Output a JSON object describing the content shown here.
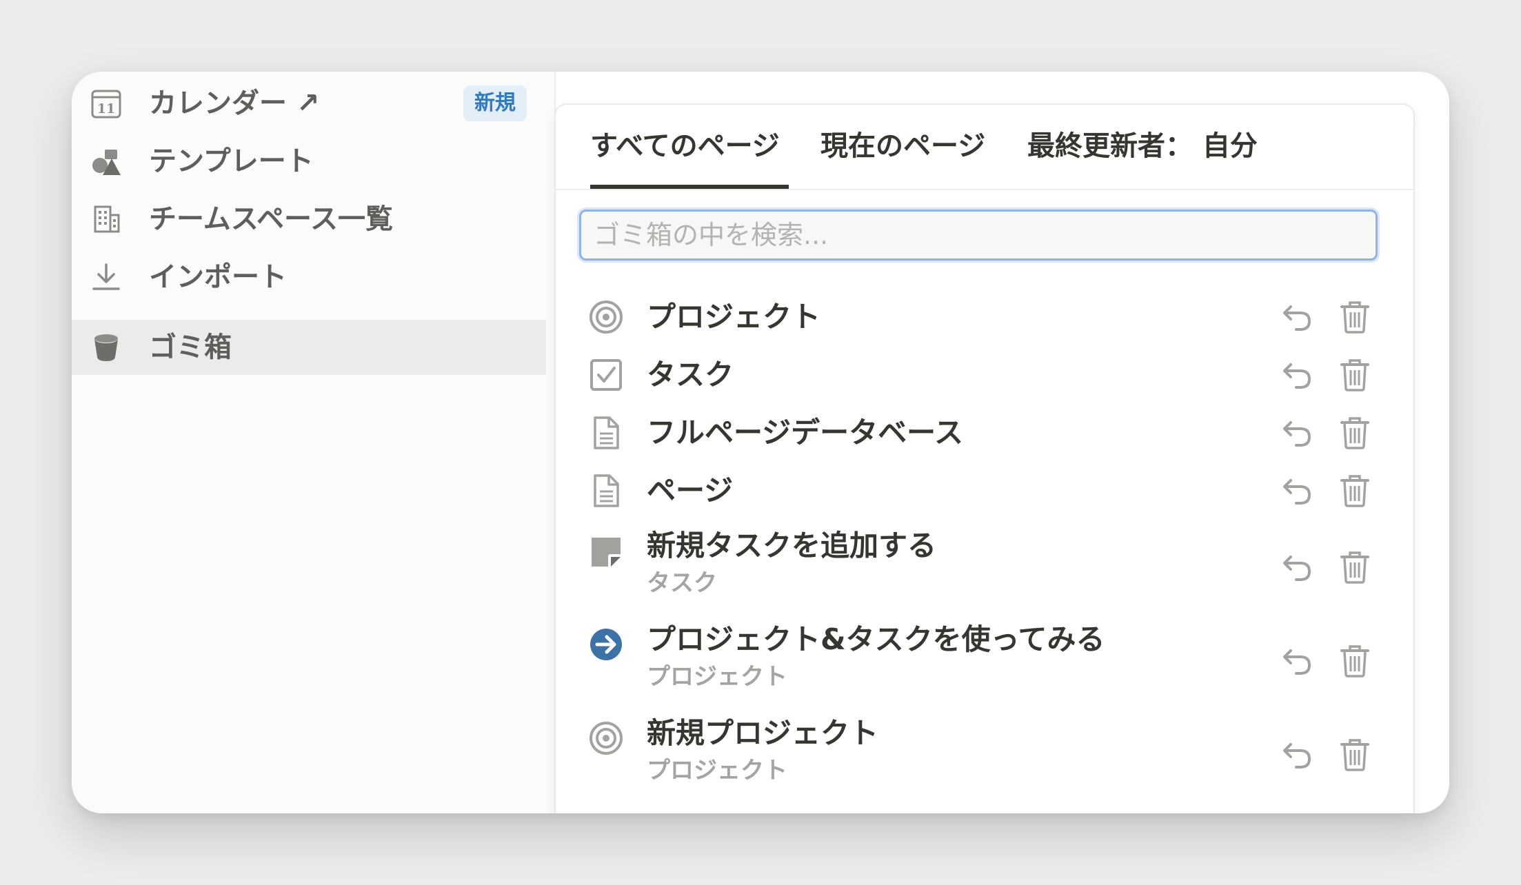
{
  "sidebar": {
    "items": [
      {
        "label": "カレンダー ↗",
        "icon": "calendar-icon",
        "icon_text": "11",
        "badge": "新規"
      },
      {
        "label": "テンプレート",
        "icon": "template-shapes-icon"
      },
      {
        "label": "チームスペース一覧",
        "icon": "building-icon"
      },
      {
        "label": "インポート",
        "icon": "download-icon"
      },
      {
        "label": "ゴミ箱",
        "icon": "trash-bin-icon",
        "active": true
      }
    ]
  },
  "trash": {
    "tabs": [
      {
        "label": "すべてのページ",
        "active": true
      },
      {
        "label": "現在のページ"
      },
      {
        "label": "最終更新者： 自分"
      }
    ],
    "search": {
      "placeholder": "ゴミ箱の中を検索...",
      "value": ""
    },
    "items": [
      {
        "title": "プロジェクト",
        "icon": "target-icon"
      },
      {
        "title": "タスク",
        "icon": "checkbox-icon"
      },
      {
        "title": "フルページデータベース",
        "icon": "document-icon"
      },
      {
        "title": "ページ",
        "icon": "document-icon"
      },
      {
        "title": "新規タスクを追加する",
        "subtitle": "タスク",
        "icon": "sticky-note-icon"
      },
      {
        "title": "プロジェクト&タスクを使ってみる",
        "subtitle": "プロジェクト",
        "icon": "arrow-circle-icon"
      },
      {
        "title": "新規プロジェクト",
        "subtitle": "プロジェクト",
        "icon": "target-icon"
      }
    ],
    "actions": {
      "restore_icon": "restore-icon",
      "delete_icon": "delete-icon"
    }
  },
  "colors": {
    "background": "#ececec",
    "sidebar_bg": "#fbfbfa",
    "active_item_bg": "#ebebea",
    "badge_bg": "#e3eef8",
    "badge_text": "#2f7ac4",
    "search_focus": "#8db4ea",
    "text_primary": "#37352f",
    "text_secondary": "#a5a4a0",
    "icon_gray": "#a3a29e",
    "arrow_icon_blue": "#3b72a8"
  }
}
